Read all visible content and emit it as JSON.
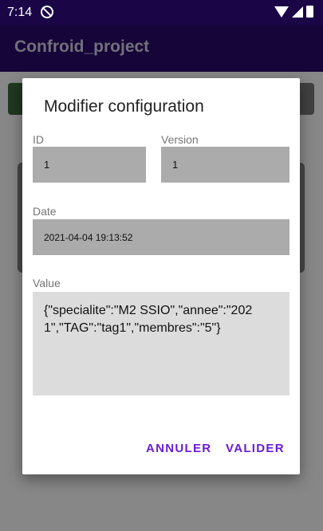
{
  "status_bar": {
    "time": "7:14"
  },
  "app_bar": {
    "title": "Confroid_project"
  },
  "dialog": {
    "title": "Modifier configuration",
    "fields": {
      "id": {
        "label": "ID",
        "value": "1"
      },
      "version": {
        "label": "Version",
        "value": "1"
      },
      "date": {
        "label": "Date",
        "value": "2021-04-04 19:13:52"
      },
      "value": {
        "label": "Value",
        "value": "{\"specialite\":\"M2 SSIO\",\"annee\":\"2021\",\"TAG\":\"tag1\",\"membres\":\"5\"}"
      }
    },
    "buttons": {
      "cancel": "ANNULER",
      "confirm": "VALIDER"
    }
  },
  "colors": {
    "accent": "#6a1bd9",
    "app_bar": "#2a0a6a",
    "status_bar": "#1a0547"
  }
}
